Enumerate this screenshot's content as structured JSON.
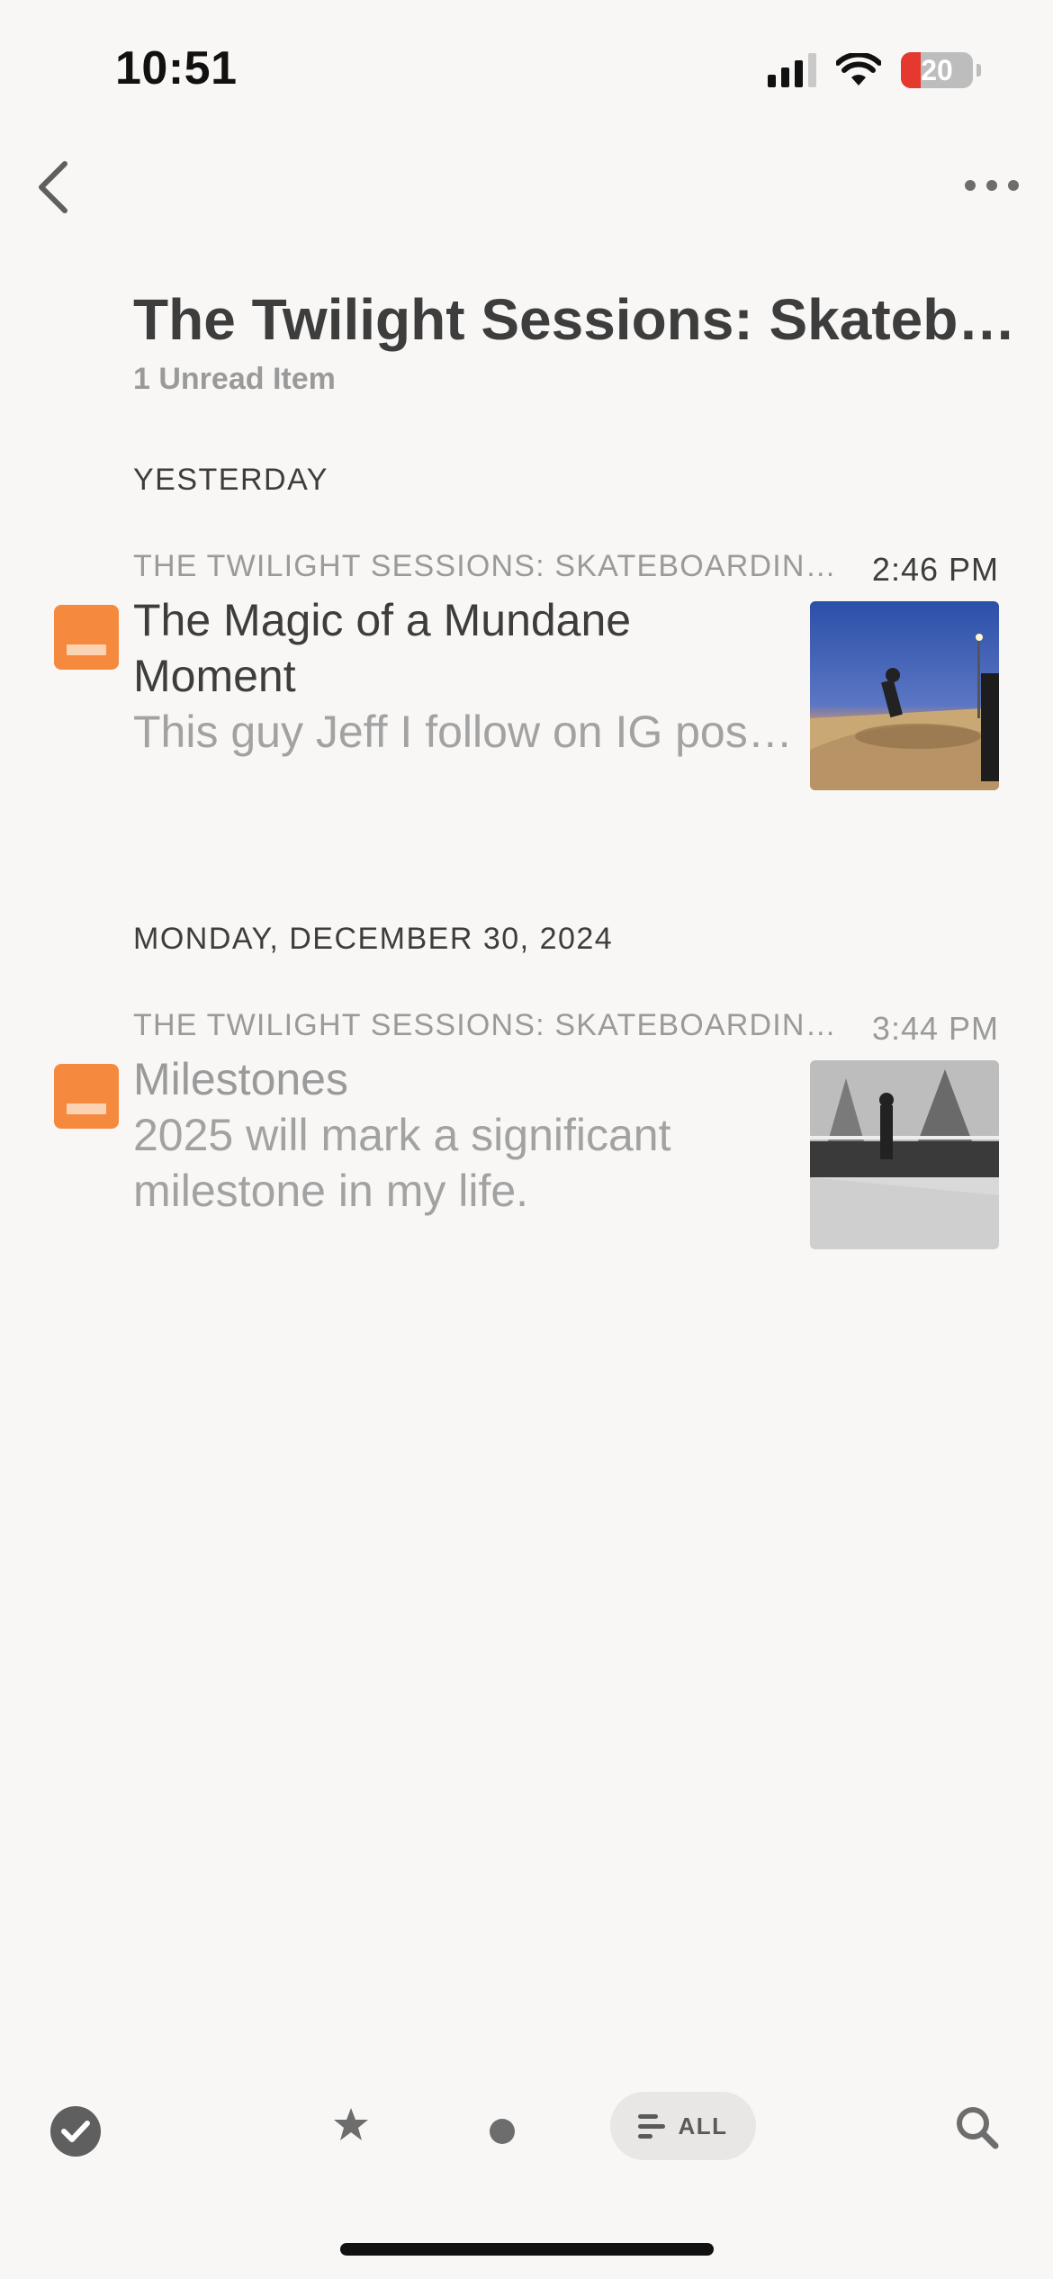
{
  "status_bar": {
    "time": "10:51",
    "battery_level": "20",
    "battery_color": "#e5392f"
  },
  "nav": {
    "back_icon": "chevron-left-icon",
    "more_icon": "ellipsis-icon"
  },
  "header": {
    "title": "The Twilight Sessions: Skateb…",
    "unread": "1 Unread Item"
  },
  "sections": [
    {
      "date": "YESTERDAY",
      "items": [
        {
          "source": "THE TWILIGHT SESSIONS: SKATEBOARDING…",
          "time": "2:46 PM",
          "title": "The Magic of a Mundane Moment",
          "excerpt": "This guy Jeff I follow on IG pos…",
          "unread": true,
          "thumbnail": "skatepark-sunset-photo"
        }
      ]
    },
    {
      "date": "MONDAY, DECEMBER 30, 2024",
      "items": [
        {
          "source": "THE TWILIGHT SESSIONS: SKATEBOARDING…",
          "time": "3:44 PM",
          "title": "Milestones",
          "excerpt": "2025 will mark a significant milestone in my life.",
          "unread": false,
          "thumbnail": "skatepark-black-white-photo"
        }
      ]
    }
  ],
  "toolbar": {
    "mark_read_icon": "checkmark-circle-icon",
    "starred_icon": "star-icon",
    "unread_icon": "dot-icon",
    "all_label": "ALL",
    "search_icon": "search-icon"
  },
  "colors": {
    "accent": "#f58a3f",
    "background": "#f8f7f5"
  }
}
